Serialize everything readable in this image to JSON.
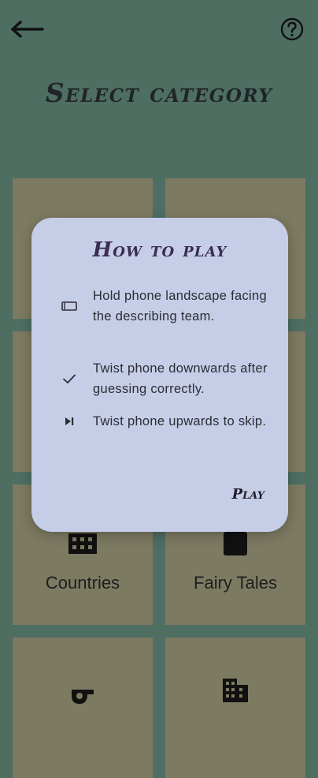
{
  "header": {
    "back_icon": "arrow-left-icon",
    "help_icon": "help-circle-icon",
    "title": "Select category"
  },
  "categories": [
    {
      "label": "",
      "icon": "person-icon"
    },
    {
      "label": "",
      "icon": "tower-icon"
    },
    {
      "label": "",
      "icon": "unknown-icon"
    },
    {
      "label": "",
      "icon": "unknown-icon"
    },
    {
      "label": "Countries",
      "icon": "grid-flag-icon"
    },
    {
      "label": "Fairy Tales",
      "icon": "castle-icon"
    },
    {
      "label": "",
      "icon": "whistle-icon"
    },
    {
      "label": "",
      "icon": "building-icon"
    }
  ],
  "dialog": {
    "title": "How to play",
    "instructions": [
      {
        "icon": "phone-landscape-icon",
        "text": "Hold phone landscape facing the describing team."
      },
      {
        "icon": "check-icon",
        "text": "Twist phone downwards after guessing correctly."
      },
      {
        "icon": "skip-next-icon",
        "text": "Twist phone upwards to skip."
      }
    ],
    "play_label": "Play"
  },
  "colors": {
    "background": "#4e6e62",
    "tile": "#7d7a62",
    "dialog": "#c6cde7",
    "dialog_title": "#3a2c52"
  }
}
